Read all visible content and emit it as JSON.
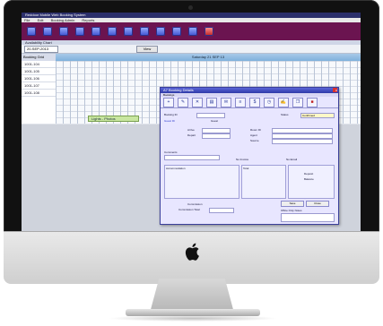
{
  "app": {
    "title": "Reddoor Mobile Web Booking System"
  },
  "menu": [
    "File",
    "Edit",
    "Booking Admin",
    "Reports"
  ],
  "subbar": {
    "label": "Availability Chart"
  },
  "filters": {
    "date": "20-SEP-2013",
    "view_label": "Day",
    "view_button": "View"
  },
  "left_head": "Booking Grid",
  "rooms": [
    "1001-104",
    "1001-105",
    "1001-106",
    "1001-107",
    "1001-108"
  ],
  "grid_head": "Saturday 21 SEP 13",
  "booking_bar": "Lights - Photos",
  "dialog": {
    "title": "A7 Booking Details",
    "subtitle": "Bookings",
    "close": "x",
    "labels": {
      "booking_id": "Booking ID",
      "guest": "Guest ID",
      "arrive": "Arrive",
      "depart": "Depart",
      "status": "Status",
      "room_id": "Room ID",
      "agent": "Agent",
      "source": "Source",
      "notes": "Comments",
      "accom": "Accommodation",
      "total": "Total",
      "deposit": "Deposit",
      "balance": "Balance",
      "other": "Office Only Notes",
      "commission": "Commission",
      "commission_total": "Commission Total"
    },
    "values": {
      "status": "Confirmed",
      "guest": "Guest",
      "booked": "Booked"
    },
    "checks": {
      "no_invoice": "No Invoice",
      "no_email": "No Email"
    },
    "buttons": {
      "save": "Save",
      "cancel": "Close"
    }
  }
}
